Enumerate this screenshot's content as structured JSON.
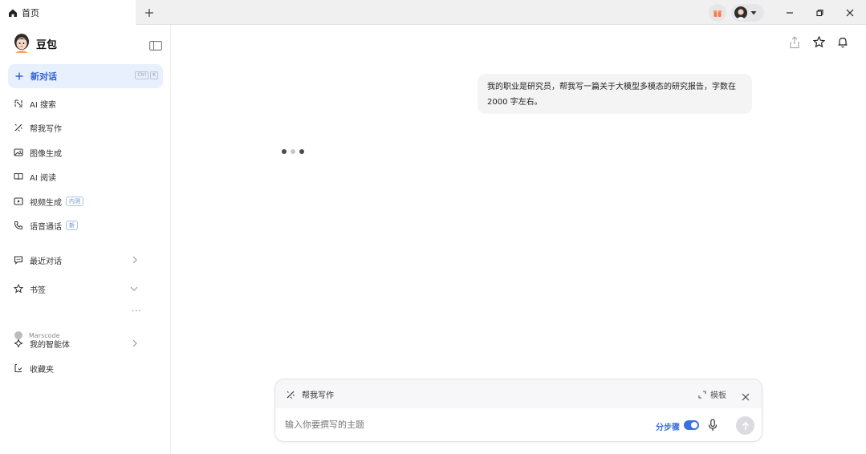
{
  "colors": {
    "accent": "#3b6fe0",
    "new_chat_bg": "#e8f0fe",
    "titlebar": "#f0f0f1",
    "bubble": "#f4f4f5",
    "gift": "#ef7d4a"
  },
  "tab": {
    "title": "首页",
    "icon": "home-icon"
  },
  "sidebar": {
    "brand": "豆包",
    "new_chat": {
      "label": "新对话",
      "shortcut": [
        "Ctrl",
        "K"
      ]
    },
    "items": [
      {
        "label": "AI 搜索",
        "icon": "search-icon"
      },
      {
        "label": "帮我写作",
        "icon": "pen-icon"
      },
      {
        "label": "图像生成",
        "icon": "image-icon"
      },
      {
        "label": "AI 阅读",
        "icon": "read-icon"
      },
      {
        "label": "视频生成",
        "icon": "video-icon",
        "badge": "内测"
      },
      {
        "label": "语音通话",
        "icon": "phone-icon",
        "badge": "新"
      }
    ],
    "recent": "最近对话",
    "bookmarks": {
      "label": "书签",
      "more": "···"
    },
    "marscode": "Marscode",
    "agents": "我的智能体",
    "favorites": "收藏夹"
  },
  "chat": {
    "user_message": "我的职业是研究员，帮我写一篇关于大模型多模态的研究报告，字数在 2000 字左右。",
    "typing_dots": 3
  },
  "composer": {
    "skill_label": "帮我写作",
    "template_label": "模板",
    "placeholder": "输入你要撰写的主题",
    "step_label": "分步骤",
    "step_enabled": true
  }
}
